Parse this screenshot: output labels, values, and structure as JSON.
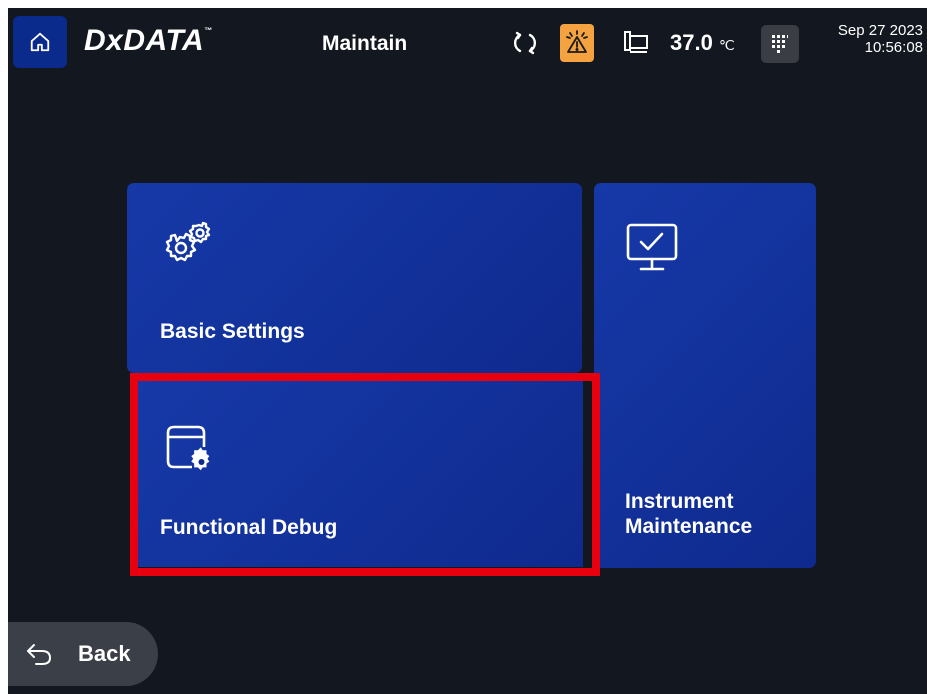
{
  "header": {
    "logo": "DxDATA",
    "logo_tm": "™",
    "title": "Maintain",
    "temperature": "37.0",
    "temperature_unit": "℃",
    "date": "Sep 27 2023",
    "time": "10:56:08",
    "icons": [
      "home-icon",
      "sync-icon",
      "warning-icon",
      "device-icon",
      "keypad-icon"
    ],
    "alarm_color": "#f4a340"
  },
  "tiles": {
    "basic_settings": "Basic Settings",
    "functional_debug": "Functional Debug",
    "instrument_maintenance": "Instrument Maintenance"
  },
  "footer": {
    "back_label": "Back"
  },
  "colors": {
    "tile_blue": "#1639a8",
    "highlight": "#e8000f",
    "background": "#13171f"
  }
}
